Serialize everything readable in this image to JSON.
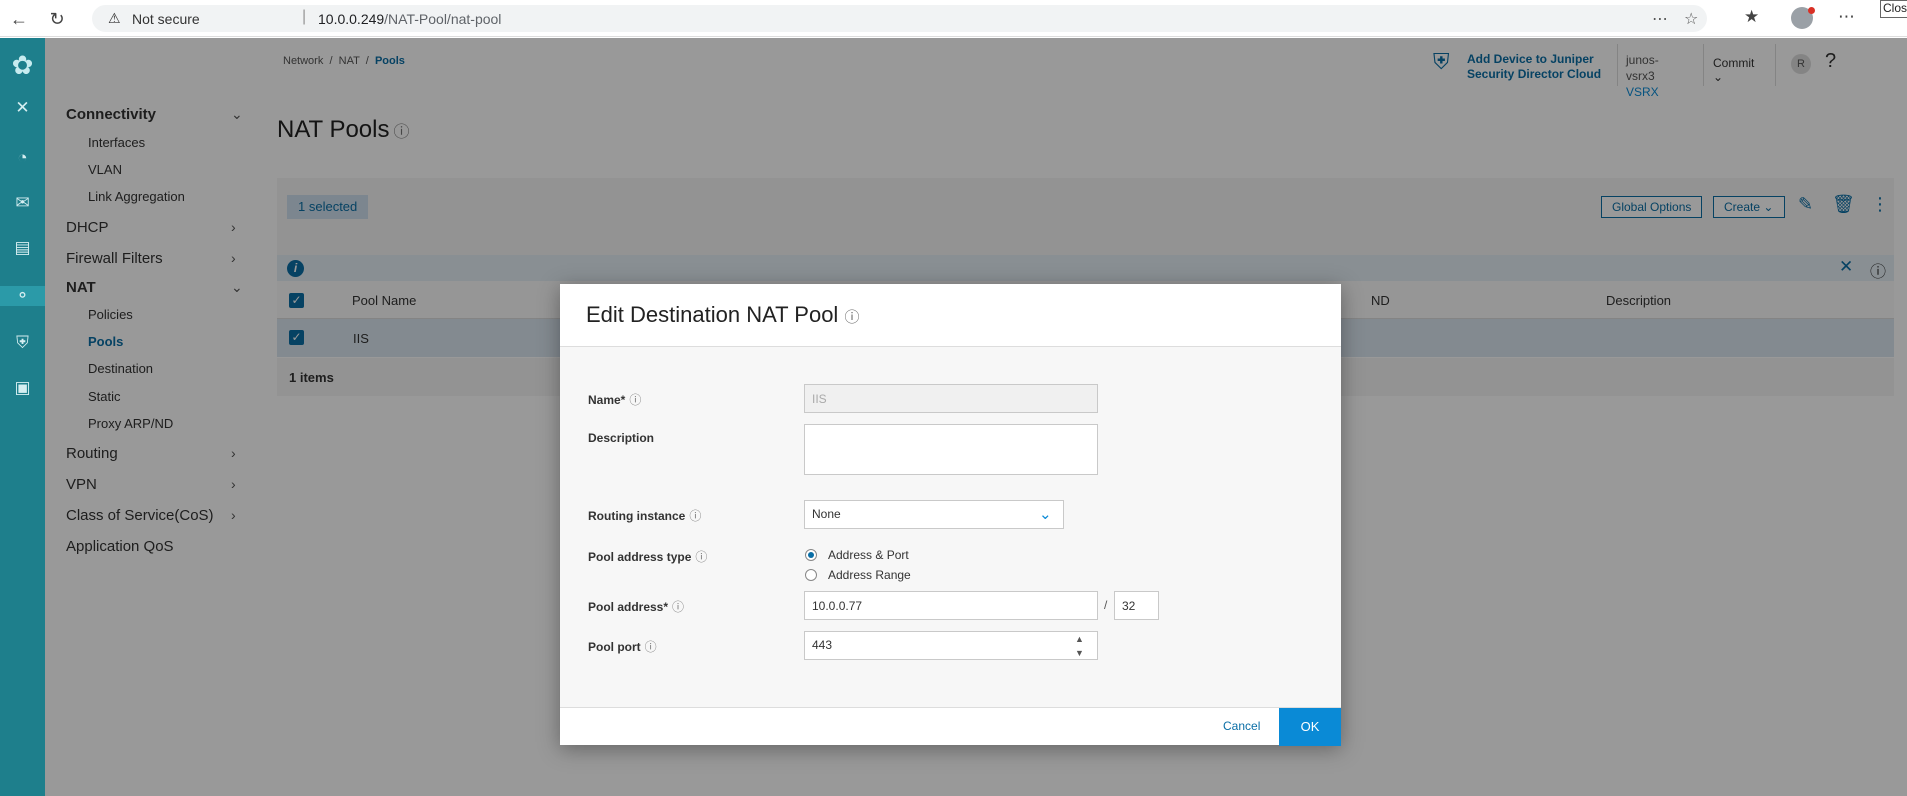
{
  "browser": {
    "security_label": "Not secure",
    "url_host": "10.0.0.249",
    "url_path": "/NAT-Pool/nat-pool",
    "close_tooltip": "Close"
  },
  "sidenav": {
    "groups": [
      {
        "label": "Connectivity",
        "bold": true,
        "expanded": true,
        "items": [
          "Interfaces",
          "VLAN",
          "Link Aggregation"
        ]
      },
      {
        "label": "DHCP",
        "bold": false,
        "expanded": false
      },
      {
        "label": "Firewall Filters",
        "bold": false,
        "expanded": false
      },
      {
        "label": "NAT",
        "bold": true,
        "expanded": true,
        "items": [
          "Policies",
          "Pools",
          "Destination",
          "Static",
          "Proxy ARP/ND"
        ],
        "active_item": "Pools"
      },
      {
        "label": "Routing",
        "bold": false,
        "expanded": false
      },
      {
        "label": "VPN",
        "bold": false,
        "expanded": false
      },
      {
        "label": "Class of Service(CoS)",
        "bold": false,
        "expanded": false
      },
      {
        "label": "Application QoS",
        "bold": false,
        "expanded": false
      }
    ]
  },
  "header": {
    "breadcrumb": [
      "Network",
      "NAT",
      "Pools"
    ],
    "promo_line1": "Add Device to Juniper",
    "promo_line2": "Security Director Cloud",
    "device_name": "junos-vsrx3",
    "device_model": "VSRX",
    "commit_label": "Commit",
    "user_initial": "R",
    "help_label": "?"
  },
  "page": {
    "title": "NAT Pools"
  },
  "grid": {
    "selected_badge": "1 selected",
    "global_options_label": "Global Options",
    "create_label": "Create",
    "columns": [
      "Pool Name",
      "ND",
      "Description"
    ],
    "rows": [
      {
        "pool_name": "IIS"
      }
    ],
    "footer": "1 items"
  },
  "modal": {
    "title": "Edit Destination NAT Pool",
    "fields": {
      "name_label": "Name*",
      "name_value": "IIS",
      "description_label": "Description",
      "description_value": "",
      "routing_label": "Routing instance",
      "routing_value": "None",
      "pool_type_label": "Pool address type",
      "pool_type_options": [
        "Address & Port",
        "Address Range"
      ],
      "pool_type_selected": "Address & Port",
      "pool_address_label": "Pool address*",
      "pool_address_value": "10.0.0.77",
      "pool_address_sep": "/",
      "pool_prefix_value": "32",
      "pool_port_label": "Pool port",
      "pool_port_value": "443"
    },
    "cancel_label": "Cancel",
    "ok_label": "OK"
  },
  "colors": {
    "rail": "#1e7f8c",
    "accent": "#0a6ea6",
    "ok_button": "#0a8ad6"
  }
}
